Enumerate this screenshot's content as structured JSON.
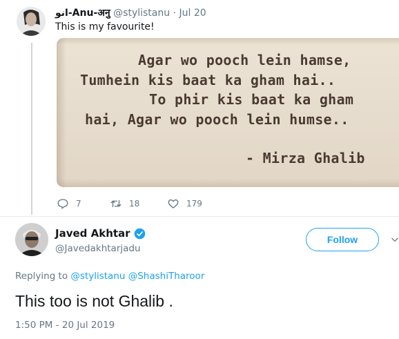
{
  "tweet1": {
    "display_name": "انو-Anu-अनु",
    "handle": "@stylistanu",
    "separator": "·",
    "date": "Jul 20",
    "text": "This is my favourite!",
    "image_lines": [
      "Agar wo pooch lein hamse,",
      "Tumhein kis baat ka gham hai..",
      "To phir kis baat ka gham",
      "hai, Agar wo pooch lein humse..",
      "- Mirza Ghalib"
    ],
    "actions": {
      "reply_count": "7",
      "retweet_count": "18",
      "like_count": "179"
    }
  },
  "tweet2": {
    "display_name": "Javed Akhtar",
    "handle": "@Javedakhtarjadu",
    "follow_label": "Follow",
    "replying_prefix": "Replying to",
    "replying_to": [
      "@stylistanu",
      "@ShashiTharoor"
    ],
    "text": "This too is not Ghalib .",
    "timestamp": "1:50 PM - 20 Jul 2019"
  },
  "colors": {
    "accent": "#1da1f2",
    "secondary_text": "#657786",
    "primary_text": "#14171a",
    "divider": "#e6ecf0",
    "quote_ink": "#4a3a32",
    "quote_paper": "#e7ddce"
  },
  "icons": [
    "reply-icon",
    "retweet-icon",
    "like-icon",
    "verified-badge-icon",
    "chevron-down-icon"
  ]
}
